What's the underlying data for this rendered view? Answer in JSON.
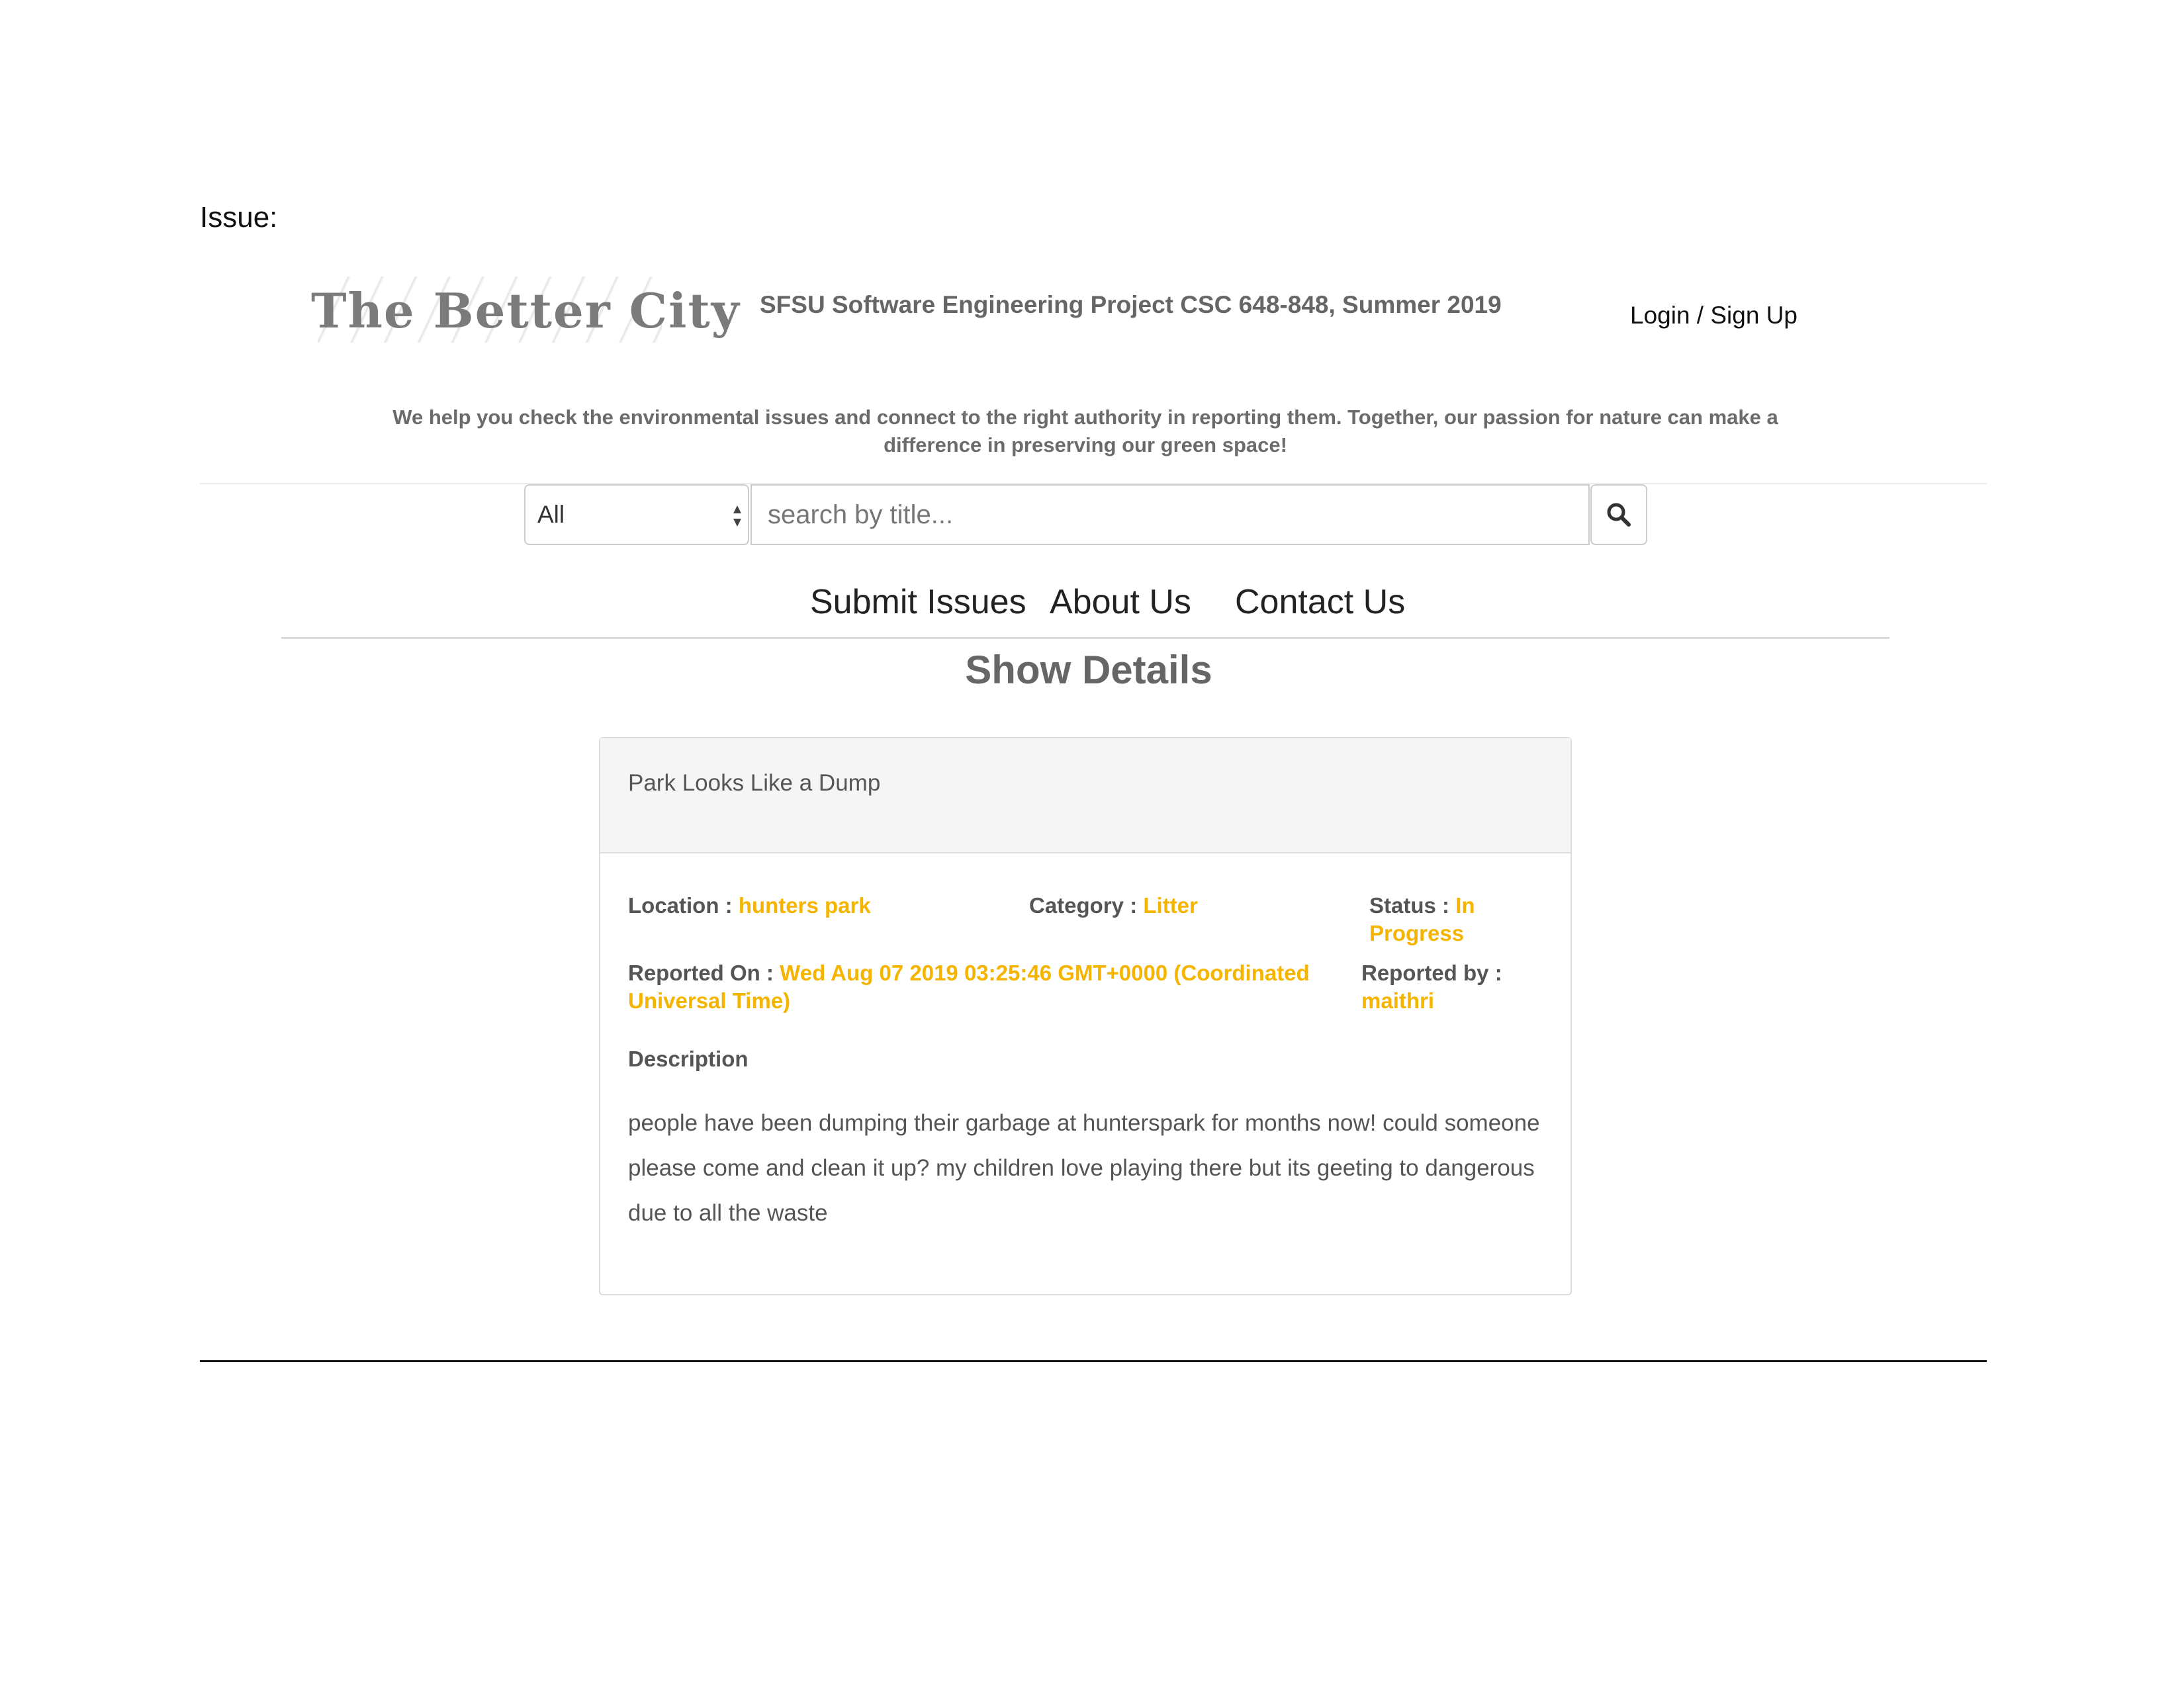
{
  "document": {
    "label": "Issue:"
  },
  "header": {
    "logo_text": "The Better City",
    "project_title": "SFSU Software Engineering Project CSC 648-848, Summer 2019",
    "login_label": "Login / Sign Up",
    "tagline": "We help you check the environmental issues and connect to the right authority in reporting them. Together, our passion for nature can make a difference in preserving our green space!"
  },
  "search": {
    "category_selected": "All",
    "placeholder": "search by title..."
  },
  "nav": {
    "items": [
      {
        "label": "Submit Issues"
      },
      {
        "label": "About Us"
      },
      {
        "label": "Contact Us"
      }
    ]
  },
  "page": {
    "heading": "Show Details"
  },
  "issue": {
    "title": "Park Looks Like a Dump",
    "location_label": "Location :",
    "location": "hunters park",
    "category_label": "Category :",
    "category": "Litter",
    "status_label": "Status :",
    "status": "In Progress",
    "reported_on_label": "Reported On :",
    "reported_on": "Wed Aug 07 2019 03:25:46 GMT+0000 (Coordinated Universal Time)",
    "reported_by_label": "Reported by :",
    "reported_by": "maithri",
    "description_label": "Description",
    "description": "people have been dumping their garbage at hunterspark for months now! could someone please come and clean it up? my children love playing there but its geeting to dangerous due to all the waste"
  },
  "colors": {
    "accent": "#f4b400",
    "muted_text": "#555555"
  },
  "icons": {
    "search_button": "search-icon",
    "select_arrows": "select-arrows-icon"
  }
}
